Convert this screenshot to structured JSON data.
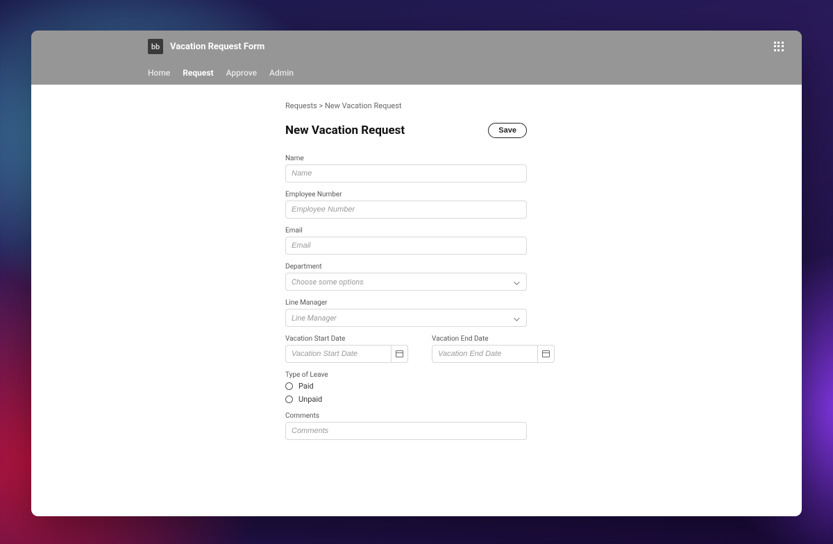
{
  "app": {
    "logo_text": "bb",
    "title": "Vacation Request Form"
  },
  "nav": {
    "items": [
      {
        "label": "Home",
        "active": false
      },
      {
        "label": "Request",
        "active": true
      },
      {
        "label": "Approve",
        "active": false
      },
      {
        "label": "Admin",
        "active": false
      }
    ]
  },
  "breadcrumb": {
    "parent": "Requests",
    "separator": ">",
    "current": "New Vacation Request"
  },
  "page": {
    "title": "New Vacation Request",
    "save_label": "Save"
  },
  "fields": {
    "name": {
      "label": "Name",
      "placeholder": "Name",
      "value": ""
    },
    "employee_number": {
      "label": "Employee Number",
      "placeholder": "Employee Number",
      "value": ""
    },
    "email": {
      "label": "Email",
      "placeholder": "Email",
      "value": ""
    },
    "department": {
      "label": "Department",
      "placeholder": "Choose some options",
      "value": ""
    },
    "line_manager": {
      "label": "Line Manager",
      "placeholder": "Line Manager",
      "value": ""
    },
    "vacation_start": {
      "label": "Vacation Start Date",
      "placeholder": "Vacation Start Date",
      "value": ""
    },
    "vacation_end": {
      "label": "Vacation End Date",
      "placeholder": "Vacation End Date",
      "value": ""
    },
    "type_of_leave": {
      "label": "Type of Leave",
      "options": [
        {
          "label": "Paid",
          "selected": false
        },
        {
          "label": "Unpaid",
          "selected": false
        }
      ]
    },
    "comments": {
      "label": "Comments",
      "placeholder": "Comments",
      "value": ""
    }
  }
}
